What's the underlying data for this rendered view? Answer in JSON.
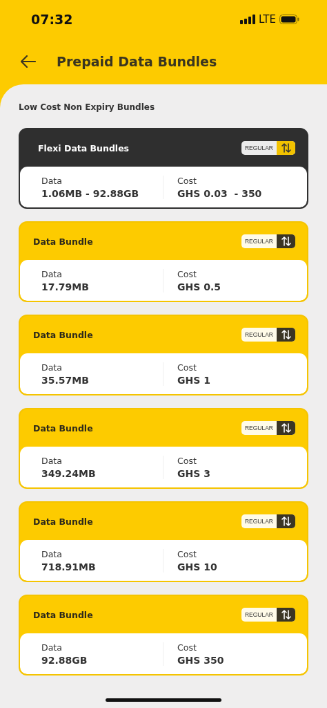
{
  "status_bar": {
    "time": "07:32",
    "network": "LTE"
  },
  "header": {
    "title": "Prepaid Data Bundles"
  },
  "section": {
    "title": "Low Cost Non Expiry Bundles"
  },
  "bundles": [
    {
      "kind": "flexi",
      "title": "Flexi Data Bundles",
      "tag": "REGULAR",
      "data_label": "Data",
      "data": "1.06MB - 92.88GB",
      "cost_label": "Cost",
      "cost": "GHS 0.03  - 350"
    },
    {
      "kind": "standard",
      "title": "Data Bundle",
      "tag": "REGULAR",
      "data_label": "Data",
      "data": "17.79MB",
      "cost_label": "Cost",
      "cost": "GHS 0.5"
    },
    {
      "kind": "standard",
      "title": "Data Bundle",
      "tag": "REGULAR",
      "data_label": "Data",
      "data": "35.57MB",
      "cost_label": "Cost",
      "cost": "GHS 1"
    },
    {
      "kind": "standard",
      "title": "Data Bundle",
      "tag": "REGULAR",
      "data_label": "Data",
      "data": "349.24MB",
      "cost_label": "Cost",
      "cost": "GHS 3"
    },
    {
      "kind": "standard",
      "title": "Data Bundle",
      "tag": "REGULAR",
      "data_label": "Data",
      "data": "718.91MB",
      "cost_label": "Cost",
      "cost": "GHS 10"
    },
    {
      "kind": "standard",
      "title": "Data Bundle",
      "tag": "REGULAR",
      "data_label": "Data",
      "data": "92.88GB",
      "cost_label": "Cost",
      "cost": "GHS 350"
    }
  ]
}
